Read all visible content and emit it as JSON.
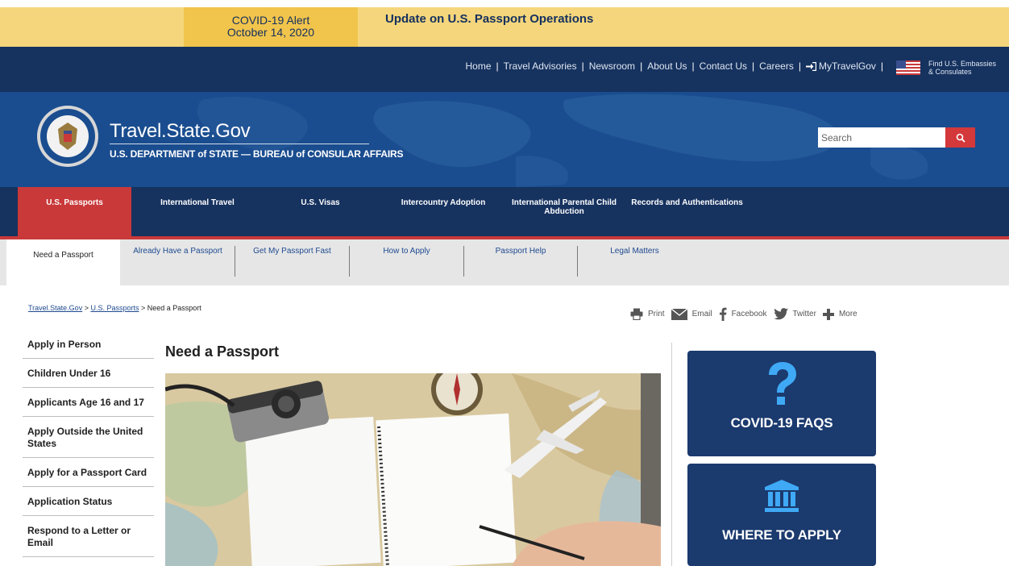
{
  "alert": {
    "label_line1": "COVID-19 Alert",
    "label_line2": "October 14, 2020",
    "title": "Update on U.S. Passport Operations"
  },
  "utility_nav": {
    "links": [
      "Home",
      "Travel Advisories",
      "Newsroom",
      "About Us",
      "Contact Us",
      "Careers"
    ],
    "my_travel_gov": "MyTravelGov",
    "embassies_line1": "Find U.S. Embassies",
    "embassies_line2": "& Consulates"
  },
  "header": {
    "site_title": "Travel.State.Gov",
    "subtitle": "U.S. DEPARTMENT of STATE — BUREAU of CONSULAR AFFAIRS",
    "search_placeholder": "Search"
  },
  "main_nav": {
    "items": [
      {
        "label": "U.S. Passports"
      },
      {
        "label": "International Travel"
      },
      {
        "label": "U.S. Visas"
      },
      {
        "label": "Intercountry Adoption"
      },
      {
        "label": "International Parental Child Abduction"
      },
      {
        "label": "Records and Authentications"
      }
    ]
  },
  "sub_nav": {
    "items": [
      {
        "label": "Need a Passport"
      },
      {
        "label": "Already Have a Passport"
      },
      {
        "label": "Get My Passport Fast"
      },
      {
        "label": "How to Apply"
      },
      {
        "label": "Passport Help"
      },
      {
        "label": "Legal Matters"
      }
    ]
  },
  "breadcrumb": {
    "home": "Travel.State.Gov",
    "sep1": " > ",
    "section": "U.S. Passports",
    "sep2": " > ",
    "current": "Need a Passport"
  },
  "share": {
    "print": "Print",
    "email": "Email",
    "facebook": "Facebook",
    "twitter": "Twitter",
    "more": "More"
  },
  "sidebar": {
    "items": [
      "Apply in Person",
      "Children Under 16",
      "Applicants Age 16 and 17",
      "Apply Outside the United States",
      "Apply for a Passport Card",
      "Application Status",
      "Respond to a Letter or Email"
    ]
  },
  "content": {
    "title": "Need a Passport"
  },
  "tiles": {
    "covid": "COVID-19 FAQS",
    "apply": "WHERE TO APPLY"
  },
  "colors": {
    "navy": "#16325f",
    "header_blue": "#1a4d8f",
    "accent_red": "#c9393a",
    "alert_yellow": "#f5d67c",
    "tile_blue": "#1b3a6e",
    "icon_blue": "#3fa9f5"
  },
  "icons": {
    "login": "sign-in-icon",
    "flag": "us-flag-icon",
    "search": "magnifier-icon",
    "print": "printer-icon",
    "email": "envelope-icon",
    "facebook": "facebook-icon",
    "twitter": "twitter-bird-icon",
    "more": "plus-icon",
    "covid_tile": "question-mark-icon",
    "apply_tile": "building-columns-icon"
  }
}
